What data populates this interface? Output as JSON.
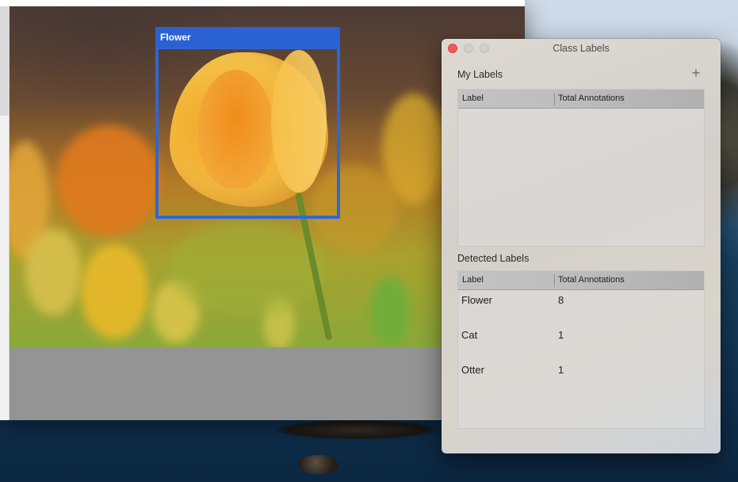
{
  "annotation": {
    "box_label": "Flower"
  },
  "panel": {
    "title": "Class Labels",
    "my_labels": {
      "title": "My Labels",
      "add_glyph": "+",
      "columns": [
        "Label",
        "Total Annotations"
      ],
      "rows": []
    },
    "detected_labels": {
      "title": "Detected Labels",
      "columns": [
        "Label",
        "Total Annotations"
      ],
      "rows": [
        {
          "label": "Flower",
          "total": "8"
        },
        {
          "label": "Cat",
          "total": "1"
        },
        {
          "label": "Otter",
          "total": "1"
        }
      ]
    }
  },
  "colors": {
    "bbox": "#2e67d6",
    "close_button": "#ee5a55"
  },
  "icons": [
    "close-window-icon",
    "minimize-window-icon",
    "zoom-window-icon",
    "plus-icon"
  ]
}
